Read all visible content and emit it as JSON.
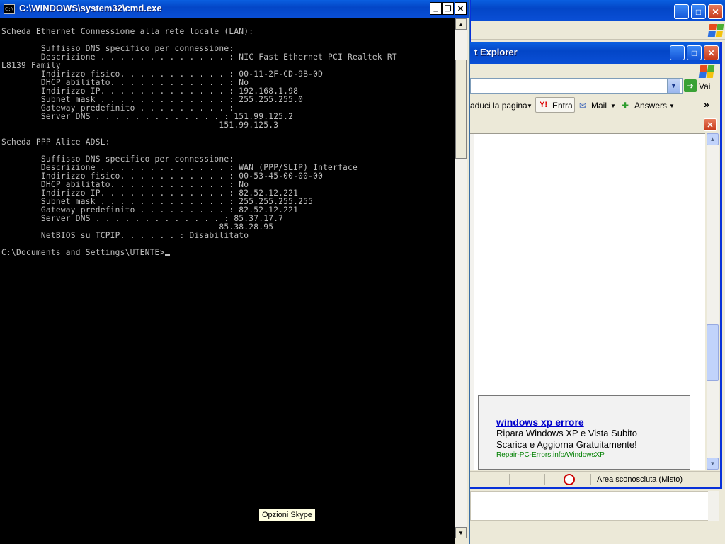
{
  "cmd_window": {
    "title": "C:\\WINDOWS\\system32\\cmd.exe",
    "icon_text": "C:\\",
    "buttons": {
      "minimize": "_",
      "restore": "❐",
      "close": "✕"
    },
    "console_text": "Scheda Ethernet Connessione alla rete locale (LAN):\n\n        Suffisso DNS specifico per connessione:\n        Descrizione . . . . . . . . . . . . . : NIC Fast Ethernet PCI Realtek RT\nL8139 Family\n        Indirizzo fisico. . . . . . . . . . . : 00-11-2F-CD-9B-0D\n        DHCP abilitato. . . . . . . . . . . . : No\n        Indirizzo IP. . . . . . . . . . . . . : 192.168.1.98\n        Subnet mask . . . . . . . . . . . . . : 255.255.255.0\n        Gateway predefinito . . . . . . . . . :\n        Server DNS . . . . . . . . . . . . . : 151.99.125.2\n                                            151.99.125.3\n\nScheda PPP Alice ADSL:\n\n        Suffisso DNS specifico per connessione:\n        Descrizione . . . . . . . . . . . . . : WAN (PPP/SLIP) Interface\n        Indirizzo fisico. . . . . . . . . . . : 00-53-45-00-00-00\n        DHCP abilitato. . . . . . . . . . . . : No\n        Indirizzo IP. . . . . . . . . . . . . : 82.52.12.221\n        Subnet mask . . . . . . . . . . . . . : 255.255.255.255\n        Gateway predefinito . . . . . . . . . : 82.52.12.221\n        Server DNS . . . . . . . . . . . . . : 85.37.17.7\n                                            85.38.28.95\n        NetBIOS su TCPIP. . . . . . : Disabilitato\n\n",
    "prompt": "C:\\Documents and Settings\\UTENTE>"
  },
  "tooltip": {
    "text": "Opzioni Skype"
  },
  "ie_window": {
    "title": "t Explorer",
    "go_label": "Vai",
    "links": {
      "translate": "aduci la pagina",
      "entra": "Entra",
      "mail": "Mail",
      "answers": "Answers",
      "more": "»"
    },
    "ad": {
      "title": "windows xp errore",
      "line1": "Ripara Windows XP e Vista Subito",
      "line2": "Scarica e Aggiorna Gratuitamente!",
      "url": "Repair-PC-Errors.info/WindowsXP"
    },
    "status_zone": "Area sconosciuta (Misto)"
  },
  "colors": {
    "xp_blue": "#0a5fe0",
    "console_bg": "#000000",
    "console_fg": "#c0c0c0",
    "ad_link": "#0000cc",
    "ad_url": "#008000",
    "tooltip_bg": "#ffffe1"
  }
}
